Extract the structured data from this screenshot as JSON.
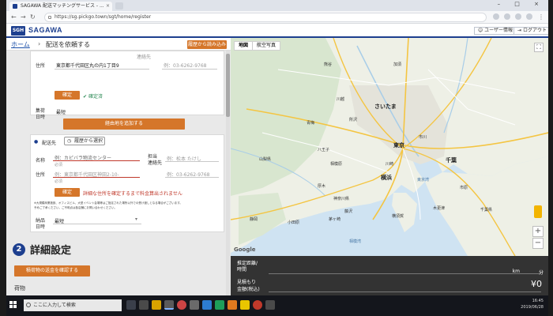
{
  "browser": {
    "tab_title": "SAGAWA 配送マッチングサービス - ...",
    "url": "https://sg.pickgo.town/sgt/home/register",
    "window_controls": "–  □  ×"
  },
  "site": {
    "logo_mark": "SGH",
    "brand": "SAGAWA",
    "user_info_button": "ユーザー情報",
    "logout_button": "ログアウト"
  },
  "breadcrumb": {
    "home": "ホーム",
    "separator": "›",
    "current": "配送を依頼する",
    "history_button": "履歴から読み込み"
  },
  "pickup": {
    "contact_label": "連絡先",
    "address_label": "住所",
    "address_value": "東京都千代田区丸の内1丁目9",
    "tel_placeholder": "例：03-6262-9768",
    "confirm_button": "確定",
    "confirmed_text": "確定済",
    "datetime_label_1": "集荷",
    "datetime_label_2": "日時",
    "datetime_value": "最短"
  },
  "add_waypoint_button": "経由地を追加する",
  "delivery": {
    "heading": "配送先",
    "history_select_button": "履歴から選択",
    "name_label": "名称",
    "name_placeholder": "例：カピバラ物流センター",
    "required_tag": "必須",
    "person_label_1": "担当",
    "person_label_2": "連絡先",
    "person_placeholder": "例：松本 たけし",
    "address_placeholder": "例：東京都千代田区神田2-10-",
    "tel_placeholder": "例：03-6262-9768",
    "confirm_button": "確定",
    "warning_text": "詳細な住所を確定するまで料金算出されません",
    "notice_line_1": "※大規模商業施設、オフィスビル、大型イベント会場等はご指定された場所以外での受け渡しとなる場合がございます。",
    "notice_line_2": "予めご了承ください。ご不明点は各店舗にお問い合わせください。",
    "datetime_label_1": "納品",
    "datetime_label_2": "日時",
    "datetime_value": "最短"
  },
  "details": {
    "step_number": "2",
    "title": "詳細設定",
    "cargo_button": "積荷物の送金を確認する",
    "cargo_label": "荷物"
  },
  "map": {
    "tab_map": "地図",
    "tab_satellite": "航空写真",
    "fullscreen_icon": "⛶",
    "zoom_in": "+",
    "zoom_out": "−",
    "logo": "Google",
    "labels": {
      "saitama": "さいたま",
      "tokyo": "東京",
      "yokohama": "横浜",
      "chiba": "千葉",
      "kawasaki": "川崎",
      "sagamihara": "相模原",
      "hachioji": "八王子",
      "yamanashi": "山梨県",
      "kanagawa": "神奈川県",
      "ome": "青梅",
      "tokorozawa": "所沢",
      "kawagoe": "川越",
      "kazo": "加須",
      "kumagaya": "熊谷",
      "kisarazu": "木更津",
      "ichihara": "市原",
      "ichikawa": "市川",
      "fujisawa": "藤沢",
      "odawara": "小田原",
      "chigasaki": "茅ヶ崎",
      "yokosuka": "横須賀",
      "atsugi": "厚木",
      "chiba_ken": "千葉県",
      "shizuoka": "静岡",
      "tokyo_bay": "東京湾",
      "sagami_bay": "相模湾"
    }
  },
  "quote": {
    "distance_label_1": "推定距離/",
    "distance_label_2": "時間",
    "distance_unit": "km",
    "time_unit": "分",
    "price_label_1": "見積もり",
    "price_label_2": "金額(税込)",
    "price_value": "¥0"
  },
  "taskbar": {
    "search_placeholder": "ここに入力して検索",
    "time": "16:45",
    "date": "2019/06/28"
  }
}
